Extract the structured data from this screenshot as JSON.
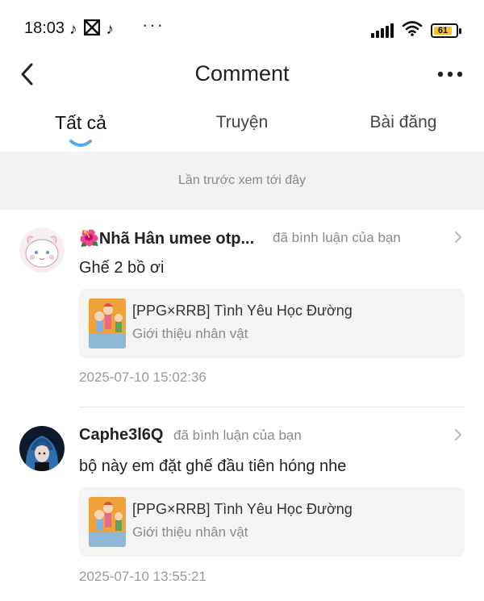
{
  "status_bar": {
    "time": "18:03",
    "app_icons": [
      "tiktok-icon",
      "capcut-icon",
      "tiktok-icon"
    ],
    "more": "···",
    "battery": "61",
    "battery_color": "#f4c221"
  },
  "header": {
    "title": "Comment",
    "back_icon": "chevron-left-icon",
    "more_icon": "more-horizontal-icon"
  },
  "tabs": [
    {
      "label": "Tất cả",
      "active": true
    },
    {
      "label": "Truyện",
      "active": false
    },
    {
      "label": "Bài đăng",
      "active": false
    }
  ],
  "accent_color": "#4fa8ef",
  "divider": {
    "text": "Lần trước xem tới đây"
  },
  "comments": [
    {
      "user_prefix": "🌺",
      "user": "Nhã Hân umee otp...",
      "action": "đã bình luận của bạn",
      "text": "Ghế 2 bồ ơi",
      "story_title": "[PPG×RRB] Tình Yêu Học Đường",
      "story_subtitle": "Giới thiệu nhân vật",
      "timestamp": "2025-07-10 15:02:36"
    },
    {
      "user_prefix": "",
      "user": "Caphe3l6Q",
      "action": "đã bình luận của bạn",
      "text": "bộ này em đặt ghế đầu tiên hóng nhe",
      "story_title": "[PPG×RRB] Tình Yêu Học Đường",
      "story_subtitle": "Giới thiệu nhân vật",
      "timestamp": "2025-07-10 13:55:21"
    }
  ]
}
